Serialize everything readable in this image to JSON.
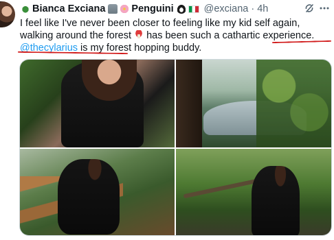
{
  "author": {
    "display_name": "Bianca Exciana",
    "name_suffix": "Penguini",
    "handle": "@exciana",
    "separator": "·",
    "time": "4h",
    "name_emojis": [
      "bug-emoji",
      "moai-emoji",
      "cherry-blossom-emoji"
    ],
    "suffix_emojis": [
      "penguin-emoji",
      "italy-flag-emoji"
    ]
  },
  "tweet": {
    "text_before_emoji": "I feel like I've never been closer to feeling like my kid self again, walking around the forest ",
    "text_after_emoji": " has been such a cathartic experience. ",
    "inline_emoji": "mushroom-emoji",
    "mention": "@thecylarius",
    "text_after_mention": " is my forest hopping buddy."
  },
  "header_icons": [
    "refresh-icon",
    "more-icon"
  ],
  "media": {
    "photo_count": 4,
    "photos": [
      "photo-1",
      "photo-2",
      "photo-3",
      "photo-4"
    ]
  },
  "colors": {
    "text": "#0f1419",
    "secondary": "#536471",
    "link": "#1d9bf0",
    "annotation": "#d11a1a"
  }
}
